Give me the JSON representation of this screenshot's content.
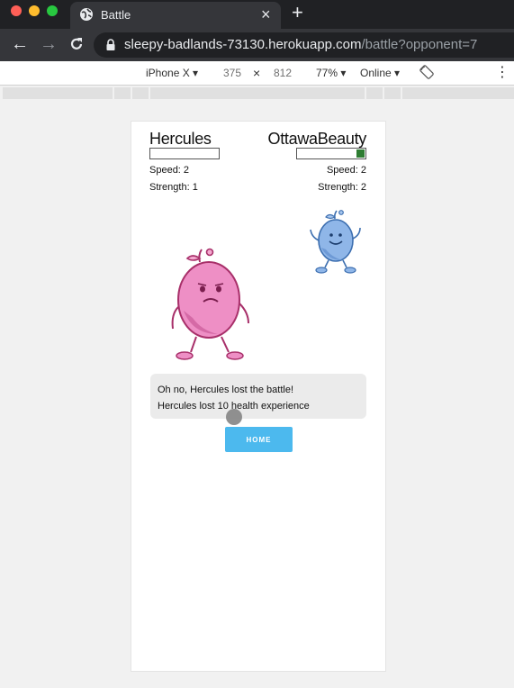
{
  "browser": {
    "tab_title": "Battle",
    "tab_close": "×",
    "new_tab": "+",
    "url_host": "sleepy-badlands-73130.herokuapp.com",
    "url_path": "/battle?opponent=7"
  },
  "device_toolbar": {
    "device": "iPhone X ▾",
    "width": "375",
    "times": "×",
    "height": "812",
    "zoom": "77% ▾",
    "network": "Online ▾",
    "more": "⋮"
  },
  "battle": {
    "player": {
      "name": "Hercules",
      "speed": "Speed: 2",
      "strength": "Strength: 1",
      "health_fraction": 0.0,
      "color": "#ee8fc5"
    },
    "opponent": {
      "name": "OttawaBeauty",
      "speed": "Speed: 2",
      "strength": "Strength: 2",
      "health_fraction": 0.12,
      "color": "#8fb6e8"
    },
    "messages": [
      "Oh no, Hercules lost the battle!",
      "Hercules lost 10 health experience"
    ],
    "home_button": "HOME"
  },
  "colors": {
    "health_fill": "#2e7d32",
    "button": "#4cb9ee"
  }
}
